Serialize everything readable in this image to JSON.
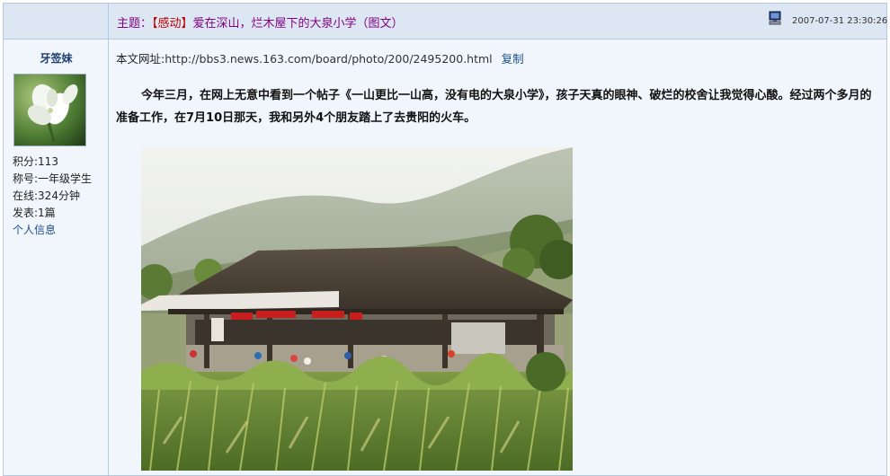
{
  "header": {
    "subject_label": "主题：",
    "subject_tag": "【感动】",
    "subject_title": "爱在深山，烂木屋下的大泉小学（图文）",
    "icon": "computer-icon",
    "post_time": "2007-07-31 23:30:26"
  },
  "user": {
    "name": "牙签妹",
    "avatar_icon": "white-flower-avatar",
    "points": "积分:113",
    "rank": "称号:一年级学生",
    "online": "在线:324分钟",
    "posts": "发表:1篇",
    "profile_link": "个人信息"
  },
  "post": {
    "url_label": "本文网址:",
    "url": "http://bbs3.news.163.com/board/photo/200/2495200.html",
    "copy_label": "复制",
    "paragraph": "今年三月，在网上无意中看到一个帖子《一山更比一山高，没有电的大泉小学》，孩子天真的眼神、破烂的校舍让我觉得心酸。经过两个多月的准备工作，在7月10日那天，我和另外4个朋友踏上了去贵阳的火车。",
    "photo": "village-school-photo"
  },
  "colors": {
    "header_bg": "#dde7f4",
    "body_bg": "#f1f6fc",
    "border": "#b6c9e0",
    "subject": "#800080",
    "link": "#1b4f8a"
  }
}
